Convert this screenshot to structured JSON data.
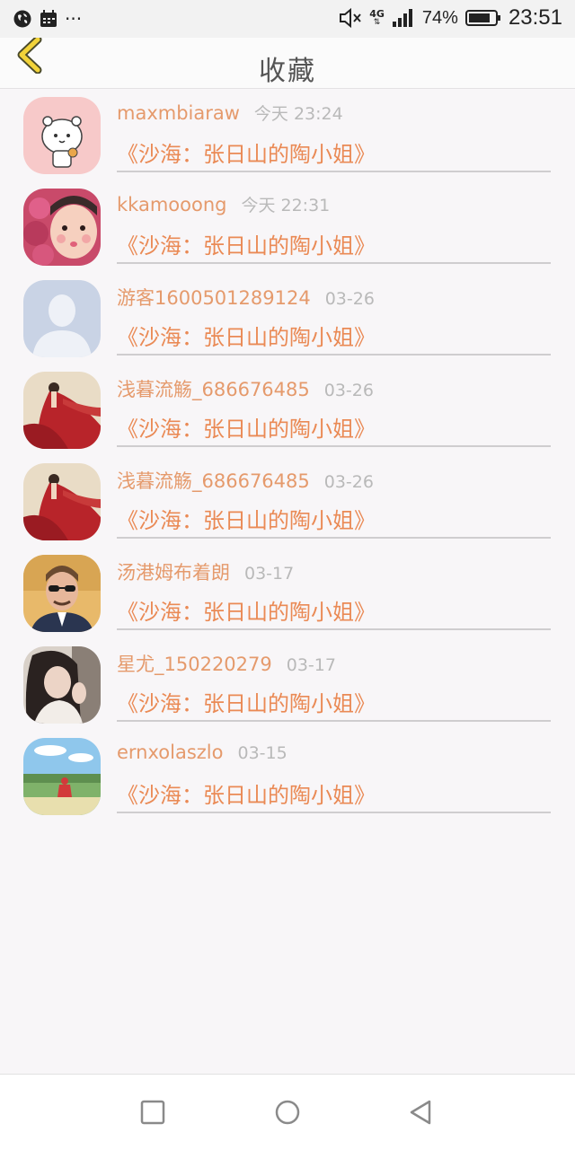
{
  "status_bar": {
    "time": "23:51",
    "battery_percent": "74%",
    "network": "4G",
    "more": "···"
  },
  "header": {
    "title": "收藏"
  },
  "favorites": [
    {
      "username": "maxmbiaraw",
      "time": "今天 23:24",
      "content": "《沙海：张日山的陶小姐》",
      "avatar": "cartoon-bear"
    },
    {
      "username": "kkamooong",
      "time": "今天 22:31",
      "content": "《沙海：张日山的陶小姐》",
      "avatar": "child-with-flowers"
    },
    {
      "username": "游客1600501289124",
      "time": "03-26",
      "content": "《沙海：张日山的陶小姐》",
      "avatar": "default-person"
    },
    {
      "username": "浅暮流觞_686676485",
      "time": "03-26",
      "content": "《沙海：张日山的陶小姐》",
      "avatar": "red-dress-figure"
    },
    {
      "username": "浅暮流觞_686676485",
      "time": "03-26",
      "content": "《沙海：张日山的陶小姐》",
      "avatar": "red-dress-figure"
    },
    {
      "username": "汤港姆布着朗",
      "time": "03-17",
      "content": "《沙海：张日山的陶小姐》",
      "avatar": "man-with-sunglasses"
    },
    {
      "username": "星尤_150220279",
      "time": "03-17",
      "content": "《沙海：张日山的陶小姐》",
      "avatar": "girl-portrait"
    },
    {
      "username": "ernxolaszlo",
      "time": "03-15",
      "content": "《沙海：张日山的陶小姐》",
      "avatar": "landscape-figure"
    }
  ]
}
